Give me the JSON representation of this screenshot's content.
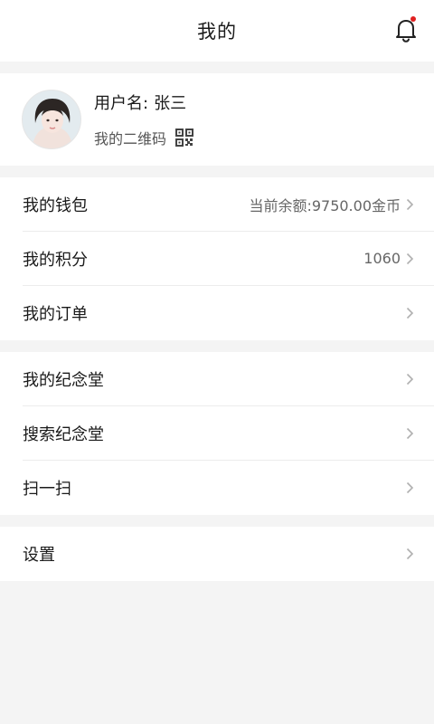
{
  "header": {
    "title": "我的",
    "bell_icon": "bell-icon",
    "has_notification": true,
    "notification_color": "#e02020"
  },
  "profile": {
    "username_label": "用户名:",
    "username_value": "张三",
    "qr_label": "我的二维码",
    "qr_icon": "qr-code-icon"
  },
  "group1": {
    "wallet": {
      "label": "我的钱包",
      "value": "当前余额:9750.00金币"
    },
    "points": {
      "label": "我的积分",
      "value": "1060"
    },
    "orders": {
      "label": "我的订单"
    }
  },
  "group2": {
    "memorial": {
      "label": "我的纪念堂"
    },
    "search_memorial": {
      "label": "搜索纪念堂"
    },
    "scan": {
      "label": "扫一扫"
    }
  },
  "group3": {
    "settings": {
      "label": "设置"
    }
  },
  "colors": {
    "background": "#f4f4f4",
    "card": "#ffffff",
    "divider": "#ececec"
  }
}
